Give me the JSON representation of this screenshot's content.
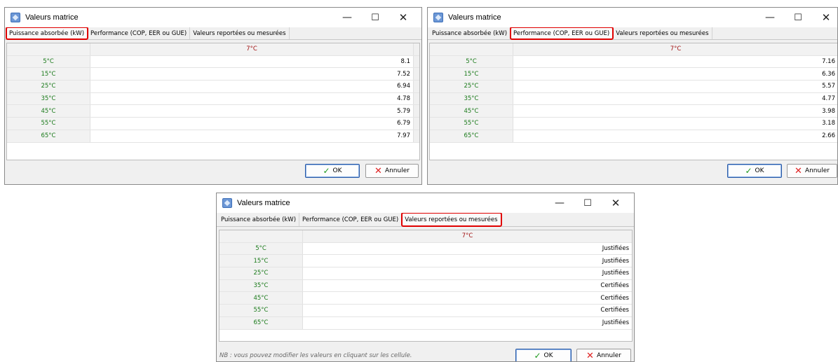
{
  "window_title": "Valeurs matrice",
  "controls": {
    "minimize": "—",
    "maximize": "☐",
    "close": "✕"
  },
  "tabs": [
    "Puissance absorbée (kW)",
    "Performance (COP, EER ou GUE)",
    "Valeurs reportées ou mesurées"
  ],
  "column_header": "7°C",
  "row_labels": [
    "5°C",
    "15°C",
    "25°C",
    "35°C",
    "45°C",
    "55°C",
    "65°C"
  ],
  "windows": [
    {
      "active_tab": 0,
      "values": [
        "8.1",
        "7.52",
        "6.94",
        "4.78",
        "5.79",
        "6.79",
        "7.97"
      ],
      "note": ""
    },
    {
      "active_tab": 1,
      "values": [
        "7.16",
        "6.36",
        "5.57",
        "4.77",
        "3.98",
        "3.18",
        "2.66"
      ],
      "note": ""
    },
    {
      "active_tab": 2,
      "values": [
        "Justifiées",
        "Justifiées",
        "Justifiées",
        "Certifiées",
        "Certifiées",
        "Certifiées",
        "Justifiées"
      ],
      "note": "NB : vous pouvez modifier les valeurs en cliquant sur les cellule."
    }
  ],
  "buttons": {
    "ok": "OK",
    "cancel": "Annuler"
  },
  "icons": {
    "app": "matrix-app-icon",
    "ok": "checkmark-icon",
    "cancel": "cross-icon"
  },
  "colors": {
    "highlight": "#e00000",
    "row_label": "#1a7a1a",
    "header_temp": "#a01010"
  }
}
